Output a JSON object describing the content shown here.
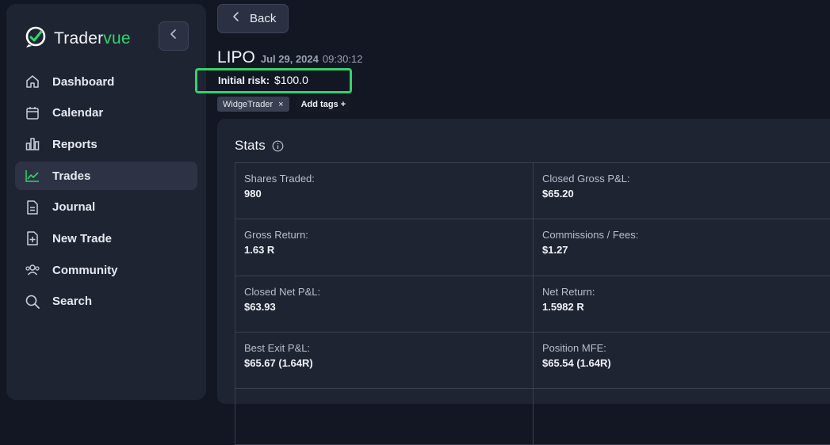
{
  "sidebar": {
    "brand": {
      "name_prefix": "Trader",
      "name_suffix": "vue",
      "accent_color": "#2fd66b"
    },
    "collapse_icon": "chevron-left-icon",
    "items": [
      {
        "label": "Dashboard",
        "icon": "home-icon",
        "active": false
      },
      {
        "label": "Calendar",
        "icon": "calendar-icon",
        "active": false
      },
      {
        "label": "Reports",
        "icon": "bar-chart-icon",
        "active": false
      },
      {
        "label": "Trades",
        "icon": "trend-line-icon",
        "active": true
      },
      {
        "label": "Journal",
        "icon": "document-icon",
        "active": false
      },
      {
        "label": "New Trade",
        "icon": "file-plus-icon",
        "active": false
      },
      {
        "label": "Community",
        "icon": "users-icon",
        "active": false
      },
      {
        "label": "Search",
        "icon": "search-icon",
        "active": false
      }
    ]
  },
  "header": {
    "back_label": "Back",
    "symbol": "LIPO",
    "date": "Jul 29, 2024",
    "time": "09:30:12"
  },
  "risk": {
    "label": "Initial risk:",
    "value": "$100.0",
    "highlight_color": "#35d16a"
  },
  "tags": {
    "items": [
      {
        "label": "WidgeTrader",
        "remove": "×"
      }
    ],
    "add_label": "Add tags +"
  },
  "stats": {
    "title": "Stats",
    "cells": [
      {
        "key": "Shares Traded:",
        "value": "980"
      },
      {
        "key": "Closed Gross P&L:",
        "value": "$65.20"
      },
      {
        "key": "Gross Return:",
        "value": "1.63 R"
      },
      {
        "key": "Commissions / Fees:",
        "value": "$1.27"
      },
      {
        "key": "Closed Net P&L:",
        "value": "$63.93"
      },
      {
        "key": "Net Return:",
        "value": "1.5982 R"
      },
      {
        "key": "Best Exit P&L:",
        "value": "$65.67 (1.64R)"
      },
      {
        "key": "Position MFE:",
        "value": "$65.54 (1.64R)"
      },
      {
        "key": "",
        "value": ""
      },
      {
        "key": "",
        "value": ""
      }
    ]
  }
}
